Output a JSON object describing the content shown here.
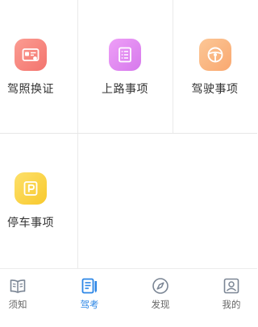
{
  "grid": {
    "items": [
      {
        "label": "驾照换证",
        "icon": "license-card-icon",
        "color": "#f58a82"
      },
      {
        "label": "上路事项",
        "icon": "document-list-icon",
        "color": "#e28bf0"
      },
      {
        "label": "驾驶事项",
        "icon": "steering-wheel-icon",
        "color": "#fbb882"
      },
      {
        "label": "停车事项",
        "icon": "parking-sign-icon",
        "color": "#fbd64a"
      }
    ]
  },
  "tabbar": {
    "active_color": "#2b86e6",
    "items": [
      {
        "label": "须知",
        "icon": "open-book-icon",
        "active": false
      },
      {
        "label": "驾考",
        "icon": "exam-note-icon",
        "active": true
      },
      {
        "label": "发现",
        "icon": "compass-icon",
        "active": false
      },
      {
        "label": "我的",
        "icon": "profile-icon",
        "active": false
      }
    ]
  }
}
